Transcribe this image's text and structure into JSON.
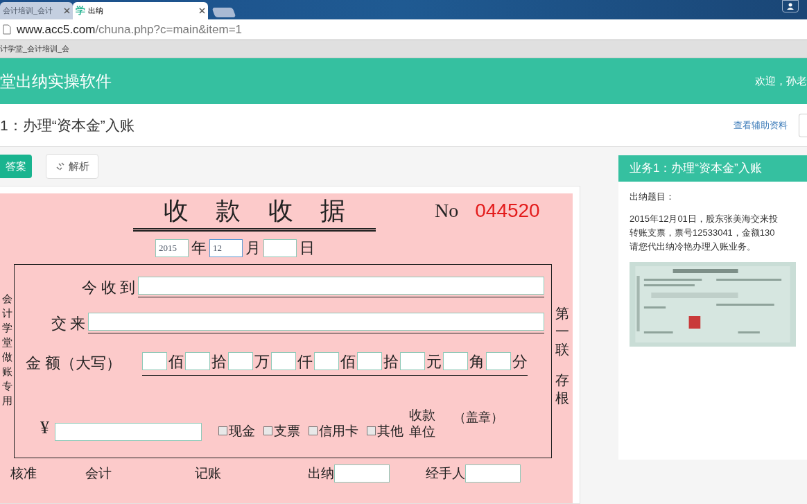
{
  "browser": {
    "tabs": [
      {
        "title": "会计培训_会计",
        "selected": false
      },
      {
        "icon": "学",
        "title": "出纳",
        "selected": true
      }
    ],
    "address": {
      "host": "www.acc5.com",
      "path": "/chuna.php?c=main&item=1"
    },
    "bookmarks": [
      "计学堂_会计培训_会"
    ]
  },
  "header": {
    "title": "堂出纳实操软件",
    "welcome": "欢迎，孙老"
  },
  "page_title": "1：办理“资本金”入账",
  "aux_link": "查看辅助资料",
  "toolbar": [
    {
      "label": "答案",
      "kind": "primary"
    },
    {
      "label": "解析",
      "kind": "default"
    }
  ],
  "receipt": {
    "title_chars": [
      "收",
      "款",
      "收",
      "据"
    ],
    "no_label": "No",
    "number": "044520",
    "date": [
      {
        "value": "2015",
        "unit": "年",
        "focused": false
      },
      {
        "value": "12",
        "unit": "月",
        "focused": true
      },
      {
        "unit": "日",
        "focused": false
      }
    ],
    "side_text": "会计学堂做账专用",
    "received_label": "今 收 到",
    "from_label": "交 来",
    "amount_label": "金 额（大写）",
    "amount_units": [
      "佰",
      "拾",
      "万",
      "仟",
      "佰",
      "拾",
      "元",
      "角",
      "分"
    ],
    "yen": "¥",
    "methods": [
      {
        "label": "现金",
        "checked": false
      },
      {
        "label": "支票",
        "checked": false
      },
      {
        "label": "信用卡",
        "checked": false
      },
      {
        "label": "其他",
        "checked": false
      }
    ],
    "payee_label": "收款单位",
    "seal": "（盖章）",
    "copy": "第一联",
    "copy_kind": "存根",
    "signatures": [
      {
        "label": "核准",
        "kind": "text"
      },
      {
        "label": "会计",
        "kind": "text"
      },
      {
        "label": "记账",
        "kind": "text"
      },
      {
        "label": "出纳",
        "kind": "field"
      },
      {
        "label": "经手人",
        "kind": "field"
      }
    ]
  },
  "task_panel": {
    "title": "业务1：办理“资本金”入账",
    "subtitle": "出纳题目：",
    "lines": [
      "2015年12月01日，股东张美海交来投",
      "转账支票，票号12533041，金额130",
      "请您代出纳冷艳办理入账业务。"
    ],
    "attachment": {
      "kind": "picture"
    }
  }
}
